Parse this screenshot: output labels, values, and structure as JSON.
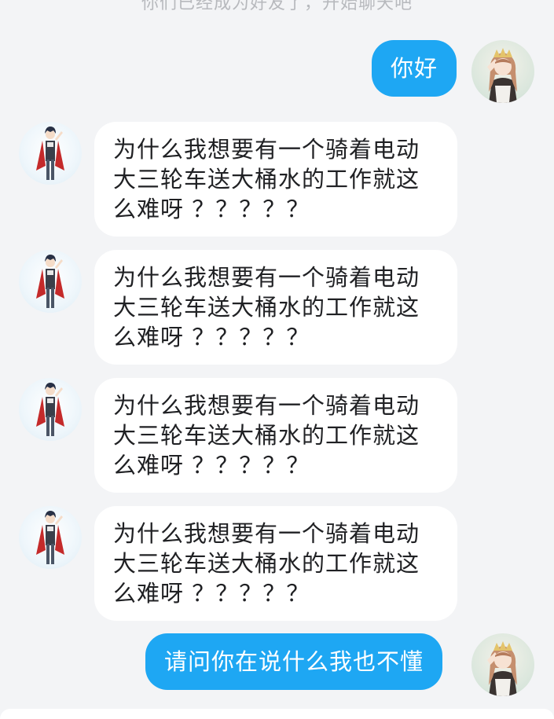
{
  "system_note": "你们已经成为好友了，开始聊天吧",
  "messages": [
    {
      "side": "right",
      "text": "你好",
      "avatar": "girl-avatar-icon"
    },
    {
      "side": "left",
      "text": "为什么我想要有一个骑着电动大三轮车送大桶水的工作就这么难呀 ？？？？？",
      "avatar": "boy-avatar-icon"
    },
    {
      "side": "left",
      "text": "为什么我想要有一个骑着电动大三轮车送大桶水的工作就这么难呀 ？？？？？",
      "avatar": "boy-avatar-icon"
    },
    {
      "side": "left",
      "text": "为什么我想要有一个骑着电动大三轮车送大桶水的工作就这么难呀 ？？？？？",
      "avatar": "boy-avatar-icon"
    },
    {
      "side": "left",
      "text": "为什么我想要有一个骑着电动大三轮车送大桶水的工作就这么难呀 ？？？？？",
      "avatar": "boy-avatar-icon"
    },
    {
      "side": "right",
      "text": "请问你在说什么我也不懂",
      "avatar": "girl-avatar-icon"
    }
  ],
  "colors": {
    "background": "#f3f4f6",
    "outgoing_bubble": "#1ea7f3",
    "incoming_bubble": "#ffffff"
  }
}
